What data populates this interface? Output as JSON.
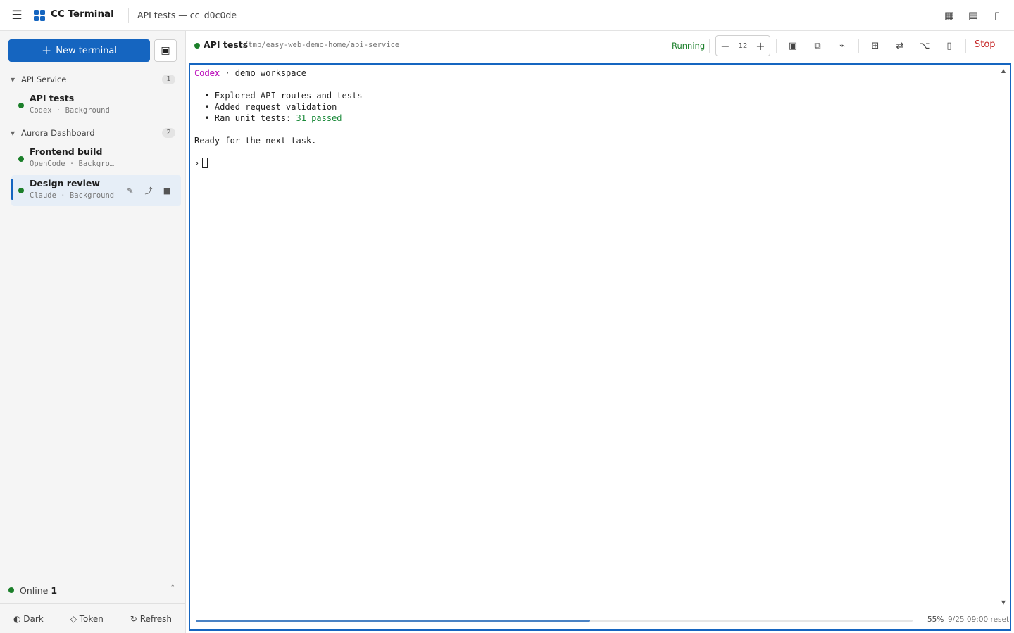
{
  "topbar": {
    "app_title": "CC Terminal",
    "subtitle": "API tests — cc_d0c0de",
    "icons": [
      "menu-icon",
      "grid-icon",
      "list-icon",
      "panel-icon"
    ]
  },
  "sidebar": {
    "new_terminal_label": "New terminal",
    "groups": [
      {
        "name": "API Service",
        "count": "1",
        "items": [
          {
            "name": "API tests",
            "meta": "Codex · Background",
            "status": "running"
          }
        ]
      },
      {
        "name": "Aurora Dashboard",
        "count": "2",
        "items": [
          {
            "name": "Frontend build",
            "meta": "OpenCode · Background",
            "status": "running"
          },
          {
            "name": "Design review",
            "meta": "Claude · Background",
            "status": "running",
            "active": true
          }
        ]
      }
    ],
    "online_label": "Online",
    "online_count": "1",
    "bottom": {
      "dark_label": "◐ Dark",
      "token_label": "◇ Token",
      "refresh_label": "↻ Refresh"
    }
  },
  "main": {
    "title": "API tests",
    "path": "/tmp/easy-web-demo-home/api-service",
    "status": "Running",
    "font_size": "12",
    "stop_label": "Stop"
  },
  "terminal": {
    "header_brand": "Codex",
    "header_rest": " · demo workspace",
    "bullets": [
      "  • Explored API routes and tests",
      "  • Added request validation",
      "  • Ran unit tests: "
    ],
    "tests_result": "31 passed",
    "ready": "Ready for the next task.",
    "prompt": "›"
  },
  "usage": {
    "percent": 55,
    "percent_label": "55%",
    "reset_label": "9/25 09:00 reset"
  },
  "colors": {
    "accent": "#1565c0",
    "running": "#1b7f2a",
    "stop": "#c62828",
    "brand_purple": "#c020c0"
  }
}
